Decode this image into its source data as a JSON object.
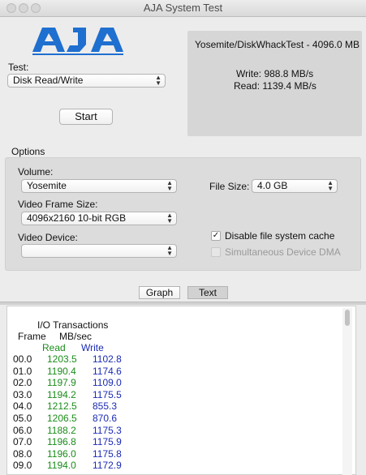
{
  "window": {
    "title": "AJA System Test"
  },
  "test": {
    "label": "Test:",
    "selected": "Disk Read/Write"
  },
  "start_button": "Start",
  "results": {
    "file": "Yosemite/DiskWhackTest - 4096.0 MB",
    "write": "Write: 988.8 MB/s",
    "read": "Read: 1139.4 MB/s"
  },
  "options": {
    "title": "Options",
    "volume_label": "Volume:",
    "volume_value": "Yosemite",
    "file_size_label": "File Size:",
    "file_size_value": "4.0 GB",
    "frame_size_label": "Video Frame Size:",
    "frame_size_value": "4096x2160 10-bit RGB",
    "device_label": "Video Device:",
    "device_value": "",
    "disable_cache_label": "Disable file system cache",
    "disable_cache_checked": true,
    "device_dma_label": "Simultaneous Device DMA",
    "device_dma_checked": false
  },
  "tabs": {
    "graph": "Graph",
    "text": "Text"
  },
  "log": {
    "heading": "I/O Transactions",
    "col_frame": "Frame",
    "col_mbsec": "MB/sec",
    "col_read": "Read",
    "col_write": "Write",
    "rows": [
      {
        "frame": "00.0",
        "read": "1203.5",
        "write": "1102.8"
      },
      {
        "frame": "01.0",
        "read": "1190.4",
        "write": "1174.6"
      },
      {
        "frame": "02.0",
        "read": "1197.9",
        "write": "1109.0"
      },
      {
        "frame": "03.0",
        "read": "1194.2",
        "write": "1175.5"
      },
      {
        "frame": "04.0",
        "read": "1212.5",
        "write": "855.3"
      },
      {
        "frame": "05.0",
        "read": "1206.5",
        "write": "870.6"
      },
      {
        "frame": "06.0",
        "read": "1188.2",
        "write": "1175.3"
      },
      {
        "frame": "07.0",
        "read": "1196.8",
        "write": "1175.9"
      },
      {
        "frame": "08.0",
        "read": "1196.0",
        "write": "1175.8"
      },
      {
        "frame": "09.0",
        "read": "1194.0",
        "write": "1172.9"
      }
    ]
  }
}
